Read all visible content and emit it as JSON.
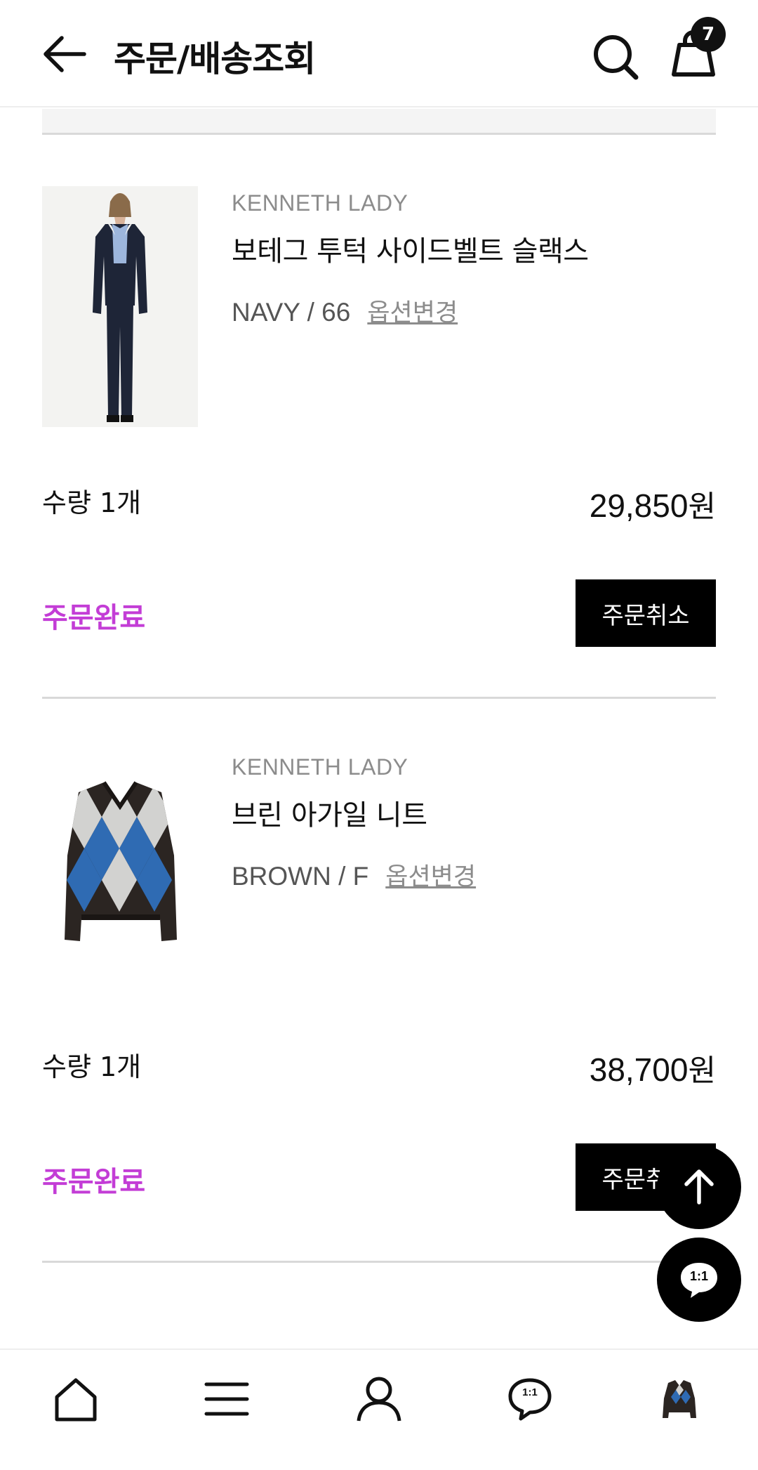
{
  "header": {
    "title": "주문/배송조회",
    "cart_count": "7"
  },
  "orders": [
    {
      "brand": "KENNETH LADY",
      "name": "보테그 투턱 사이드벨트 슬랙스",
      "option": "NAVY / 66",
      "option_change": "옵션변경",
      "quantity": "수량 1개",
      "price": "29,850",
      "price_unit": "원",
      "status": "주문완료",
      "cancel_label": "주문취소"
    },
    {
      "brand": "KENNETH LADY",
      "name": "브린 아가일 니트",
      "option": "BROWN / F",
      "option_change": "옵션변경",
      "quantity": "수량 1개",
      "price": "38,700",
      "price_unit": "원",
      "status": "주문완료",
      "cancel_label": "주문취소"
    }
  ],
  "chat_label": "1:1",
  "colors": {
    "status": "#c33dd6",
    "button_bg": "#000000",
    "divider": "#d9d9d9",
    "brand_text": "#8c8c8c"
  },
  "icons": {
    "back": "arrow-left-icon",
    "search": "search-icon",
    "cart": "shopping-bag-icon",
    "scroll_top": "arrow-up-icon",
    "chat": "chat-bubble-icon",
    "nav": [
      "home-icon",
      "menu-icon",
      "user-icon",
      "chat-bubble-icon",
      "recent-product-thumbnail"
    ]
  }
}
